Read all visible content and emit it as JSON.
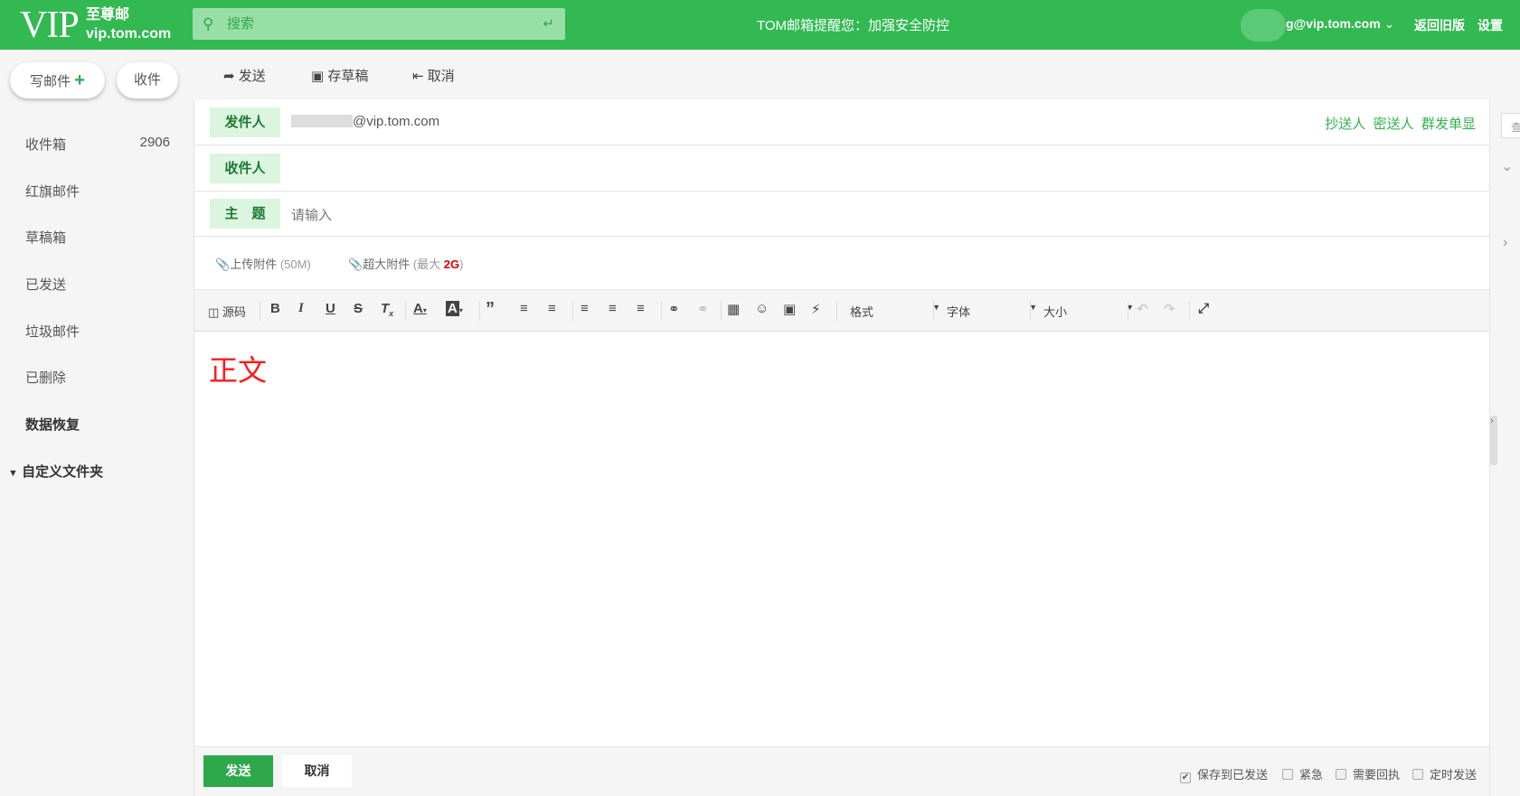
{
  "header": {
    "logo": "VIP",
    "brand": "至尊邮",
    "domain": "vip.tom.com",
    "search_placeholder": "搜索",
    "notice": "TOM邮箱提醒您：加强安全防控",
    "account": "g@vip.tom.com",
    "old_version": "返回旧版",
    "settings": "设置"
  },
  "sidebar": {
    "compose": "写邮件",
    "receive": "收件",
    "items": [
      {
        "label": "收件箱",
        "count": "2906"
      },
      {
        "label": "红旗邮件"
      },
      {
        "label": "草稿箱"
      },
      {
        "label": "已发送"
      },
      {
        "label": "垃圾邮件"
      },
      {
        "label": "已删除"
      },
      {
        "label": "数据恢复"
      }
    ],
    "custom_folders": "自定义文件夹"
  },
  "toolbar": {
    "send": "发送",
    "draft": "存草稿",
    "cancel": "取消"
  },
  "compose": {
    "from_label": "发件人",
    "from_value": "@vip.tom.com",
    "to_label": "收件人",
    "subject_label": "主　题",
    "subject_placeholder": "请输入",
    "cc": "抄送人",
    "bcc": "密送人",
    "separate": "群发单显",
    "attach": "上传附件",
    "attach_limit": "(50M)",
    "big_attach": "超大附件",
    "big_limit_prefix": "(最大",
    "big_limit": "2G",
    "big_limit_suffix": ")",
    "body": "正文"
  },
  "editor": {
    "source": "源码",
    "format": "格式",
    "font": "字体",
    "size": "大小"
  },
  "footer": {
    "send": "发送",
    "cancel": "取消",
    "options": [
      {
        "label": "保存到已发送",
        "checked": true
      },
      {
        "label": "紧急",
        "checked": false
      },
      {
        "label": "需要回执",
        "checked": false
      },
      {
        "label": "定时发送",
        "checked": false
      }
    ]
  },
  "right_panel": {
    "search_hint": "查"
  },
  "colors": {
    "brand": "#32b952",
    "send_button": "#2da84b",
    "body_text": "#ff1a1a",
    "link": "#2fb24e"
  }
}
